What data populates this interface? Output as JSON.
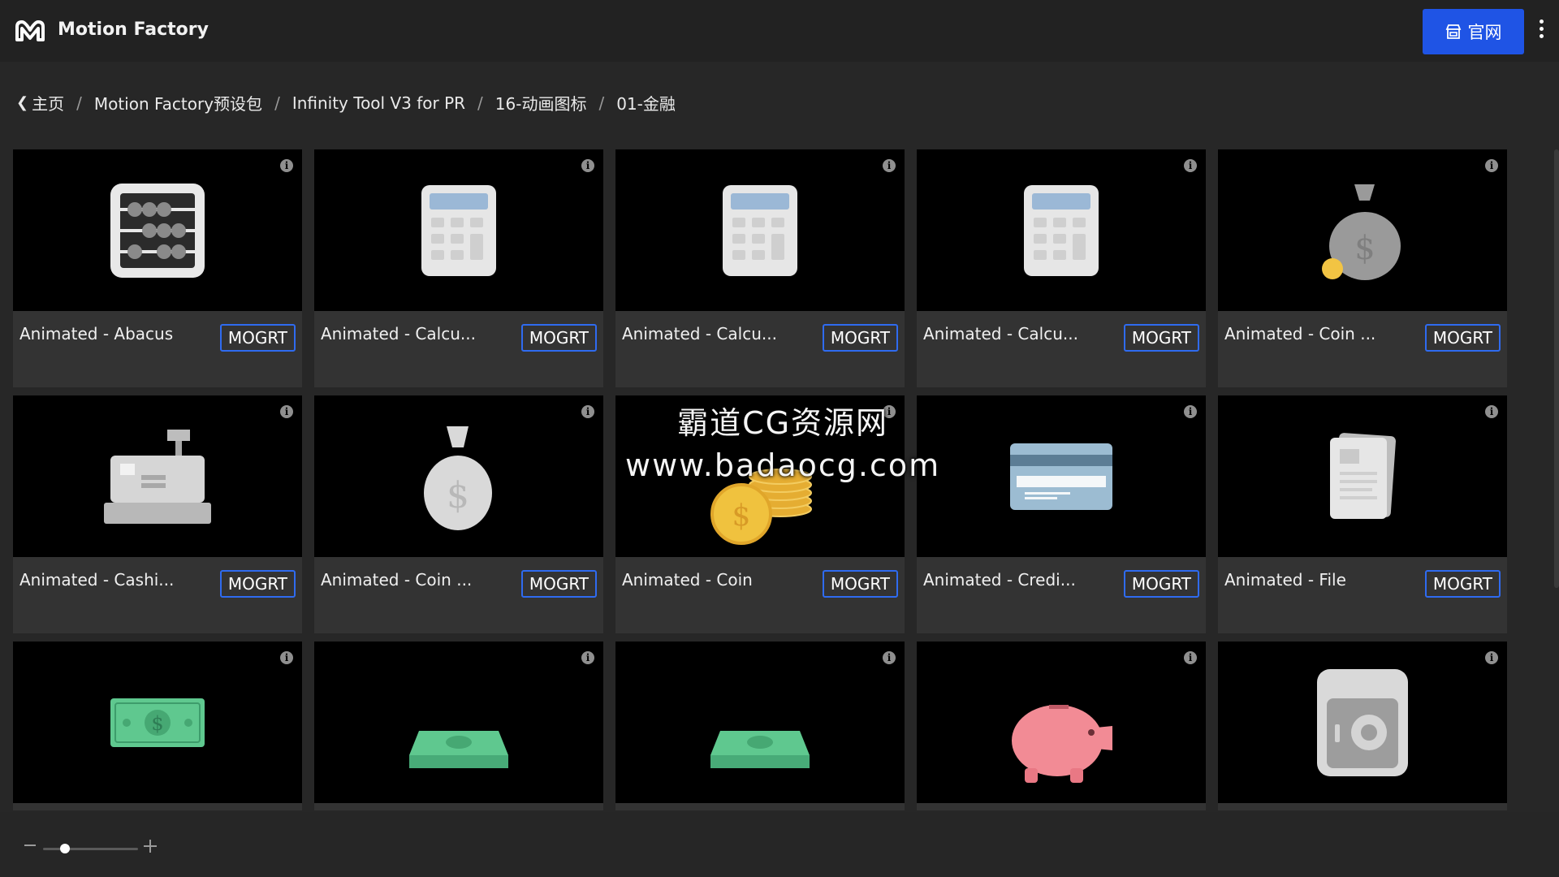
{
  "header": {
    "app_title": "Motion Factory",
    "site_button_label": "官网",
    "site_button_color": "#1f54e5"
  },
  "breadcrumb": {
    "items": [
      "主页",
      "Motion Factory预设包",
      "Infinity Tool V3 for PR",
      "16-动画图标",
      "01-金融"
    ],
    "separator": "/"
  },
  "grid": {
    "cards": [
      {
        "title": "Animated - Abacus",
        "badge": "MOGRT",
        "icon": "abacus-icon"
      },
      {
        "title": "Animated - Calcu...",
        "badge": "MOGRT",
        "icon": "calculator-icon"
      },
      {
        "title": "Animated - Calcu...",
        "badge": "MOGRT",
        "icon": "calculator-icon"
      },
      {
        "title": "Animated - Calcu...",
        "badge": "MOGRT",
        "icon": "calculator-icon"
      },
      {
        "title": "Animated - Coin ...",
        "badge": "MOGRT",
        "icon": "money-bag-coin-icon"
      },
      {
        "title": "Animated - Cashi...",
        "badge": "MOGRT",
        "icon": "cash-register-icon"
      },
      {
        "title": "Animated - Coin ...",
        "badge": "MOGRT",
        "icon": "money-bag-icon"
      },
      {
        "title": "Animated - Coin",
        "badge": "MOGRT",
        "icon": "coin-stack-icon"
      },
      {
        "title": "Animated - Credi...",
        "badge": "MOGRT",
        "icon": "credit-card-icon"
      },
      {
        "title": "Animated - File",
        "badge": "MOGRT",
        "icon": "file-icon"
      },
      {
        "title": "",
        "badge": "",
        "icon": "banknote-icon"
      },
      {
        "title": "",
        "badge": "",
        "icon": "cash-stack-icon"
      },
      {
        "title": "",
        "badge": "",
        "icon": "cash-stack-icon"
      },
      {
        "title": "",
        "badge": "",
        "icon": "piggy-bank-icon"
      },
      {
        "title": "",
        "badge": "",
        "icon": "safe-icon"
      }
    ]
  },
  "footer": {
    "zoom_level": 0.2
  },
  "watermark": {
    "line1": "霸道CG资源网",
    "line2": "www.badaocg.com"
  }
}
